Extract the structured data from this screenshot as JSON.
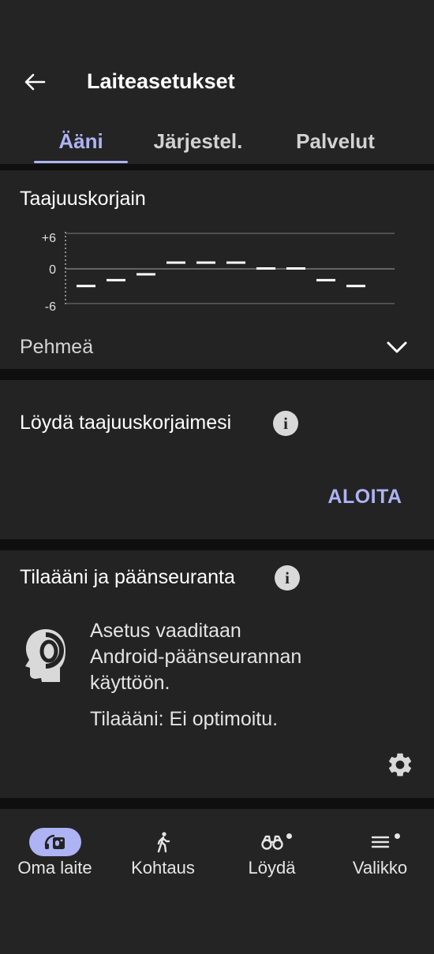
{
  "header": {
    "title": "Laiteasetukset"
  },
  "tabs": [
    {
      "label": "Ääni",
      "active": true
    },
    {
      "label": "Järjestel.",
      "active": false
    },
    {
      "label": "Palvelut",
      "active": false
    }
  ],
  "equalizer": {
    "title": "Taajuuskorjain",
    "axis_labels": [
      "+6",
      "0",
      "-6"
    ],
    "bands": [
      -3,
      -2,
      -1,
      1,
      1,
      1,
      0,
      0,
      -2,
      -3
    ],
    "preset": "Pehmeä"
  },
  "find_eq": {
    "title": "Löydä taajuuskorjaimesi",
    "action": "ALOITA"
  },
  "spatial": {
    "title": "Tilaääni ja päänseuranta",
    "lines": [
      "Asetus vaaditaan",
      "Android-päänseurannan",
      "käyttöön."
    ],
    "status": "Tilaääni: Ei optimoitu."
  },
  "bottom_nav": [
    {
      "label": "Oma laite",
      "icon": "headphones-device-icon",
      "active": true,
      "dot": false
    },
    {
      "label": "Kohtaus",
      "icon": "walking-person-icon",
      "active": false,
      "dot": false
    },
    {
      "label": "Löydä",
      "icon": "binoculars-icon",
      "active": false,
      "dot": true
    },
    {
      "label": "Valikko",
      "icon": "menu-icon",
      "active": false,
      "dot": true
    }
  ],
  "colors": {
    "background": "#232323",
    "accent": "#aeb3f4",
    "separator": "#0f0f0f"
  }
}
